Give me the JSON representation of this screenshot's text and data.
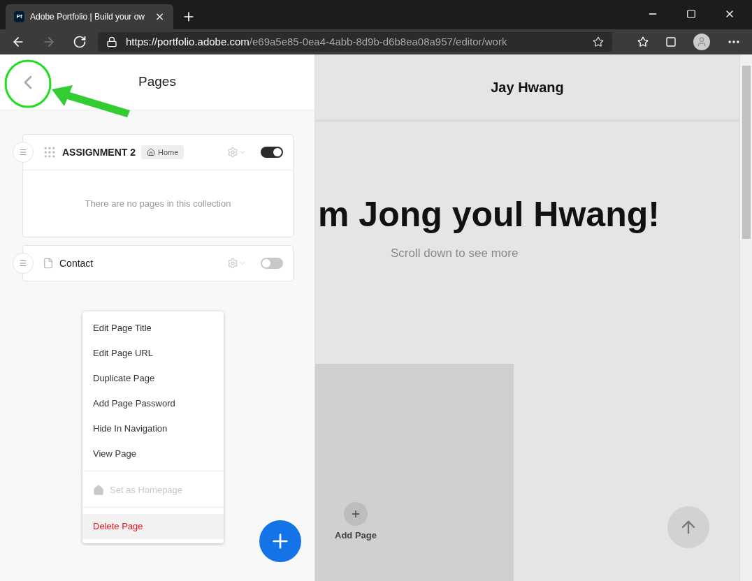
{
  "browser": {
    "tab": {
      "favicon": "Pf",
      "title": "Adobe Portfolio | Build your ow",
      "selected": true
    },
    "url": {
      "host": "https://portfolio.adobe.com",
      "path": "/e69a5e85-0ea4-4abb-8d9b-d6b8ea08a957/editor/work"
    }
  },
  "sidebar": {
    "title": "Pages",
    "pages": [
      {
        "kind": "collection",
        "name": "ASSIGNMENT 2",
        "badge": "Home",
        "on": true,
        "expanded": true,
        "empty_text": "There are no pages in this collection"
      },
      {
        "kind": "page",
        "name": "Contact",
        "on": false,
        "expanded": false
      }
    ]
  },
  "context_menu": {
    "items": [
      {
        "kind": "action",
        "label": "Edit Page Title",
        "disabled": false,
        "highlighted": false
      },
      {
        "kind": "action",
        "label": "Edit Page URL",
        "disabled": false,
        "highlighted": false
      },
      {
        "kind": "action",
        "label": "Duplicate Page",
        "disabled": false,
        "highlighted": false
      },
      {
        "kind": "action",
        "label": "Add Page Password",
        "disabled": false,
        "highlighted": false
      },
      {
        "kind": "action",
        "label": "Hide In Navigation",
        "disabled": false,
        "highlighted": false
      },
      {
        "kind": "action",
        "label": "View Page",
        "disabled": false,
        "highlighted": false
      },
      {
        "kind": "home",
        "label": "Set as Homepage",
        "disabled": true,
        "highlighted": false
      },
      {
        "kind": "danger",
        "label": "Delete Page",
        "disabled": false,
        "highlighted": true
      }
    ]
  },
  "preview": {
    "site_title": "Jay Hwang",
    "headline": "m Jong youl Hwang!",
    "subtitle": "Scroll down to see more",
    "add_page": "Add Page"
  }
}
